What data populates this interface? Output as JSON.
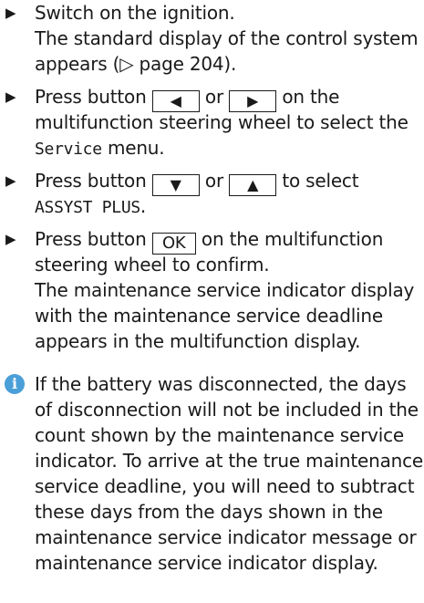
{
  "steps": [
    {
      "bullet": "▶",
      "text": "Switch on the ignition.",
      "result_line1": "The standard display of the control system",
      "result_line2": "appears (▷ page 204)."
    },
    {
      "bullet": "▶",
      "prefix": "Press button",
      "key_left": "◀",
      "or": "or",
      "key_right": "▶",
      "suffix": "on the",
      "line2": "multifunction steering wheel to select the",
      "menu_name": "Service",
      "menu_suffix": "menu."
    },
    {
      "bullet": "▶",
      "prefix": "Press button",
      "key_down": "▼",
      "or": "or",
      "key_up": "▲",
      "suffix": "to select",
      "menu_item": "ASSYST PLUS",
      "menu_item_suffix": "."
    },
    {
      "bullet": "▶",
      "prefix": "Press button",
      "key_ok": "OK",
      "suffix": "on the multifunction",
      "line2": "steering wheel to confirm.",
      "result_lines": [
        "The maintenance service indicator display",
        "with the maintenance service deadline",
        "appears in the multifunction display."
      ]
    }
  ],
  "note": {
    "icon": "info-icon",
    "icon_glyph": "i",
    "line1": "If the battery was disconnected, the days",
    "lines": [
      "of disconnection will not be included in the",
      "count shown by the maintenance service",
      "indicator. To arrive at the true maintenance",
      "service deadline, you will need to subtract",
      "these days from the days shown in the",
      "maintenance service indicator message or",
      "maintenance service indicator display."
    ]
  }
}
